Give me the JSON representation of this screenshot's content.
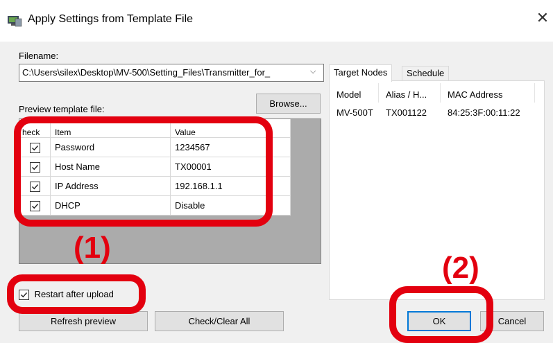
{
  "window": {
    "title": "Apply Settings from Template File",
    "close_glyph": "✕"
  },
  "filename": {
    "label": "Filename:",
    "value": "C:\\Users\\silex\\Desktop\\MV-500\\Setting_Files\\Transmitter_for_",
    "arrow": "⌵"
  },
  "browse_label": "Browse...",
  "preview_label": "Preview template file:",
  "grid": {
    "columns": [
      "heck",
      "Item",
      "Value"
    ],
    "rows": [
      {
        "checked": true,
        "item": "Password",
        "value": "1234567"
      },
      {
        "checked": true,
        "item": "Host Name",
        "value": "TX00001"
      },
      {
        "checked": true,
        "item": "IP Address",
        "value": "192.168.1.1"
      },
      {
        "checked": true,
        "item": "DHCP",
        "value": "Disable"
      }
    ]
  },
  "restart_checkbox": {
    "label": "Restart after upload",
    "checked": true
  },
  "buttons": {
    "refresh": "Refresh preview",
    "check_clear": "Check/Clear All",
    "ok": "OK",
    "cancel": "Cancel"
  },
  "tabs": [
    {
      "label": "Target Nodes",
      "active": true
    },
    {
      "label": "Schedule",
      "active": false
    }
  ],
  "nodes": {
    "columns": [
      "Model",
      "Alias / H...",
      "MAC Address"
    ],
    "rows": [
      {
        "model": "MV-500T",
        "alias": "TX001122",
        "mac": "84:25:3F:00:11:22"
      }
    ]
  },
  "annotations": {
    "label1": "(1)",
    "label2": "(2)",
    "color": "#e3000f"
  }
}
